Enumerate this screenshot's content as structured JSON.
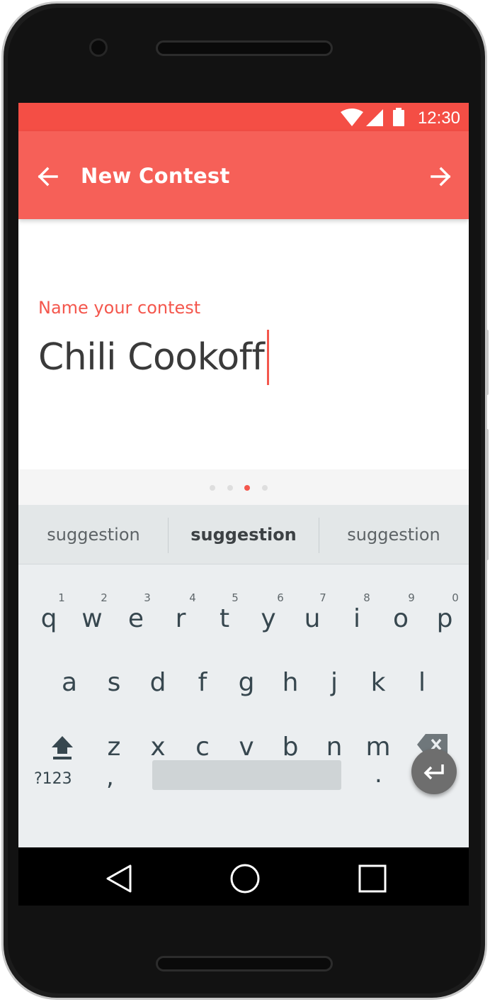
{
  "status_bar": {
    "time": "12:30",
    "icons": [
      "wifi-icon",
      "cellular-icon",
      "battery-icon"
    ],
    "color": "#f44e45"
  },
  "app_bar": {
    "title": "New Contest",
    "back_icon": "arrow-left-icon",
    "next_icon": "arrow-right-icon",
    "color": "#f66058"
  },
  "form": {
    "label": "Name your contest",
    "value": "Chili Cookoff",
    "accent": "#f4574d"
  },
  "pager": {
    "total": 4,
    "active_index": 2
  },
  "suggestions": [
    {
      "text": "suggestion",
      "bold": false
    },
    {
      "text": "suggestion",
      "bold": true
    },
    {
      "text": "suggestion",
      "bold": false
    }
  ],
  "keyboard": {
    "row1": [
      {
        "key": "q",
        "hint": "1"
      },
      {
        "key": "w",
        "hint": "2"
      },
      {
        "key": "e",
        "hint": "3"
      },
      {
        "key": "r",
        "hint": "4"
      },
      {
        "key": "t",
        "hint": "5"
      },
      {
        "key": "y",
        "hint": "6"
      },
      {
        "key": "u",
        "hint": "7"
      },
      {
        "key": "i",
        "hint": "8"
      },
      {
        "key": "o",
        "hint": "9"
      },
      {
        "key": "p",
        "hint": "0"
      }
    ],
    "row2": [
      "a",
      "s",
      "d",
      "f",
      "g",
      "h",
      "j",
      "k",
      "l"
    ],
    "row3": [
      "z",
      "x",
      "c",
      "v",
      "b",
      "n",
      "m"
    ],
    "symbols_label": "?123",
    "comma_label": ",",
    "period_label": ".",
    "shift_icon": "shift-icon",
    "backspace_icon": "backspace-icon",
    "enter_icon": "enter-icon"
  },
  "nav_bar": {
    "icons": [
      "back-triangle-icon",
      "home-circle-icon",
      "recents-square-icon"
    ]
  }
}
